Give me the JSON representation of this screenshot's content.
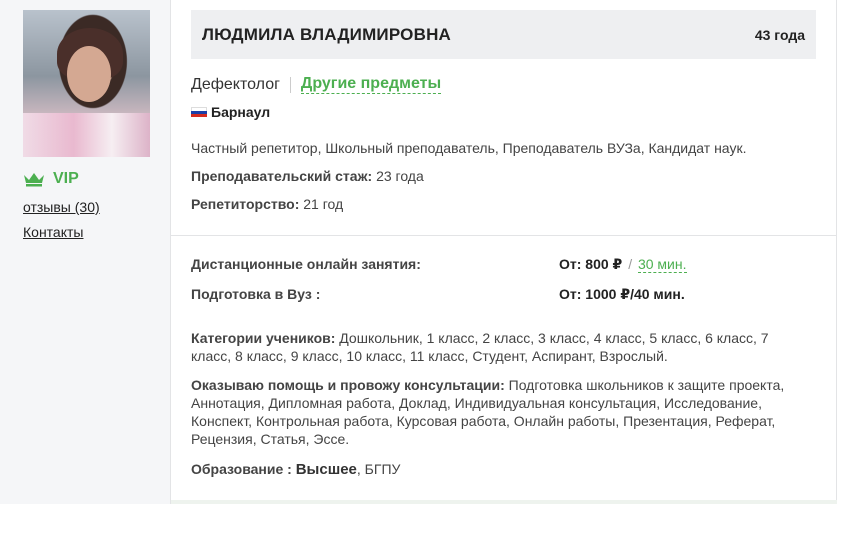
{
  "sidebar": {
    "vip_label": "VIP",
    "reviews_link": "отзывы (30)",
    "contacts_link": "Контакты",
    "vip_color": "#4caf50"
  },
  "header": {
    "name": "ЛЮДМИЛА ВЛАДИМИРОВНА",
    "age": "43 года"
  },
  "subjects": {
    "main": "Дефектолог",
    "other_link": "Другие предметы"
  },
  "city": {
    "flag_icon": "russia-flag-icon",
    "name": "Барнаул"
  },
  "profile": {
    "role": "Частный репетитор, Школьный преподаватель, Преподаватель ВУЗа, Кандидат наук.",
    "experience_label": "Преподавательский стаж:",
    "experience_value": "23 года",
    "tutoring_label": "Репетиторство:",
    "tutoring_value": "21 год"
  },
  "prices": [
    {
      "label": "Дистанционные онлайн занятия:",
      "from": "От: 800 ₽",
      "slash": "/",
      "duration": "30 мин."
    },
    {
      "label": "Подготовка в Вуз :",
      "from": "От: 1000 ₽/40 мин."
    }
  ],
  "details": {
    "categories_label": "Категории учеников:",
    "categories_value": "Дошкольник, 1 класс, 2 класс, 3 класс, 4 класс, 5 класс, 6 класс, 7 класс, 8 класс, 9 класс, 10 класс, 11 класс, Студент, Аспирант, Взрослый.",
    "help_label": "Оказываю помощь и провожу консультации:",
    "help_value": "Подготовка школьников к защите проекта, Аннотация, Дипломная работа, Доклад, Индивидуальная консультация, Исследование, Конспект, Контрольная работа, Курсовая работа, Онлайн работы, Презентация, Реферат, Рецензия, Статья, Эссе.",
    "education_label": "Образование :",
    "education_level": "Высшее",
    "education_place": ", БГПУ"
  }
}
